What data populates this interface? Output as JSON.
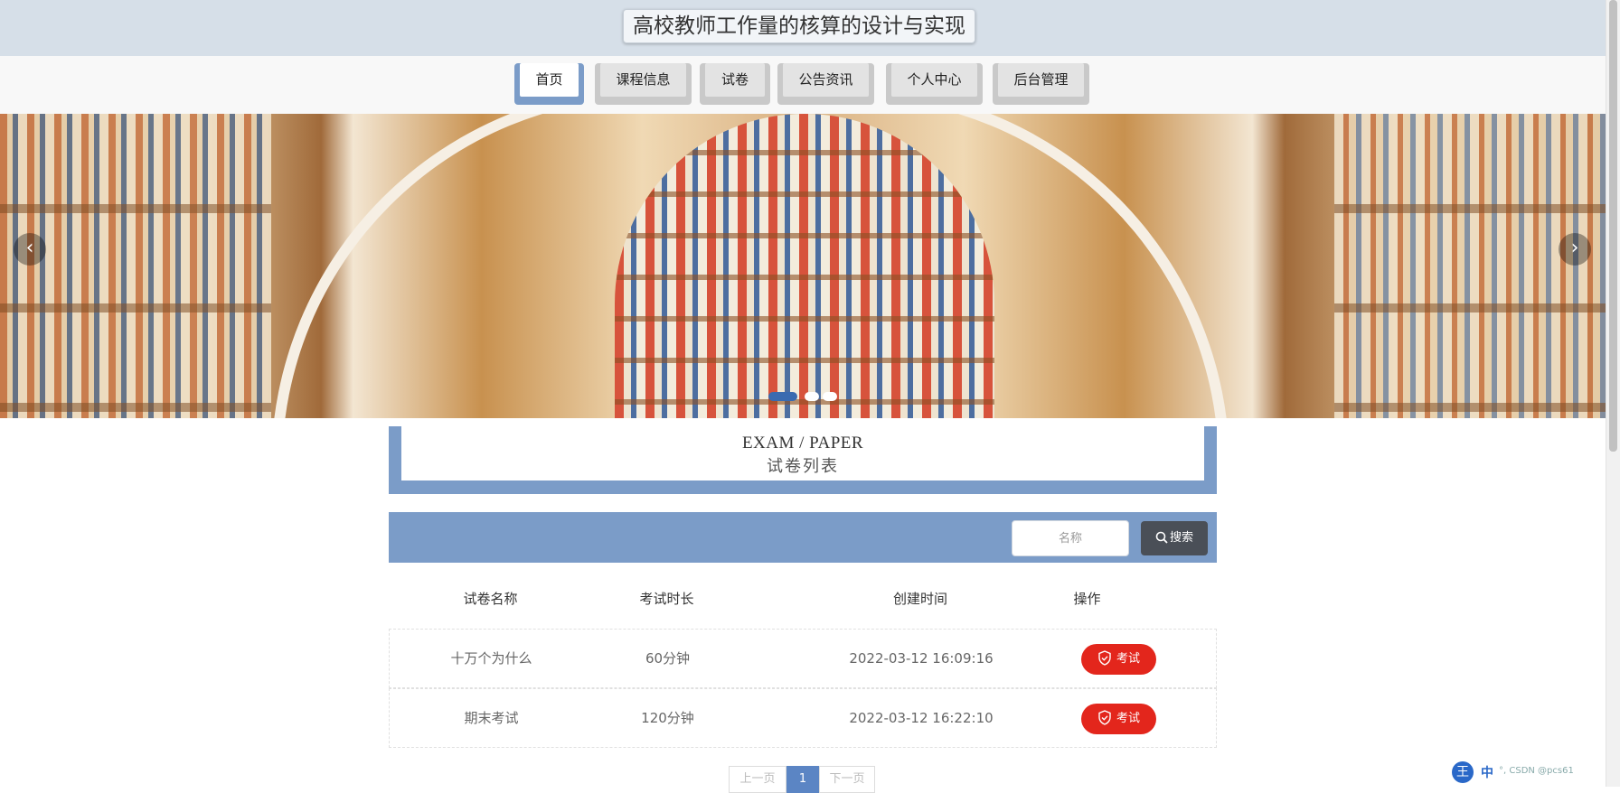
{
  "header": {
    "title": "高校教师工作量的核算的设计与实现"
  },
  "nav": {
    "items": [
      {
        "label": "首页",
        "active": true
      },
      {
        "label": "课程信息",
        "active": false
      },
      {
        "label": "试卷",
        "active": false
      },
      {
        "label": "公告资讯",
        "active": false
      },
      {
        "label": "个人中心",
        "active": false
      },
      {
        "label": "后台管理",
        "active": false
      }
    ]
  },
  "banner": {
    "prev_icon": "chevron-left-icon",
    "next_icon": "chevron-right-icon",
    "slide_count": 3,
    "active_slide": 1
  },
  "section": {
    "title_en": "EXAM / PAPER",
    "title_cn": "试卷列表"
  },
  "search": {
    "placeholder": "名称",
    "button_label": "搜索",
    "icon": "search-icon"
  },
  "table": {
    "columns": [
      "试卷名称",
      "考试时长",
      "创建时间",
      "操作"
    ],
    "rows": [
      {
        "name": "十万个为什么",
        "duration": "60分钟",
        "created": "2022-03-12 16:09:16",
        "action": "考试"
      },
      {
        "name": "期末考试",
        "duration": "120分钟",
        "created": "2022-03-12 16:22:10",
        "action": "考试"
      }
    ]
  },
  "pagination": {
    "prev": "上一页",
    "current": "1",
    "next": "下一页"
  },
  "ime": {
    "logo": "王",
    "mode": "中",
    "tray_text": "°, CSDN @pcs61"
  },
  "colors": {
    "accent": "#7b9cc8",
    "header_bg": "#d6dfe8",
    "exam_button": "#e3261c",
    "search_button": "#4a4f57"
  }
}
